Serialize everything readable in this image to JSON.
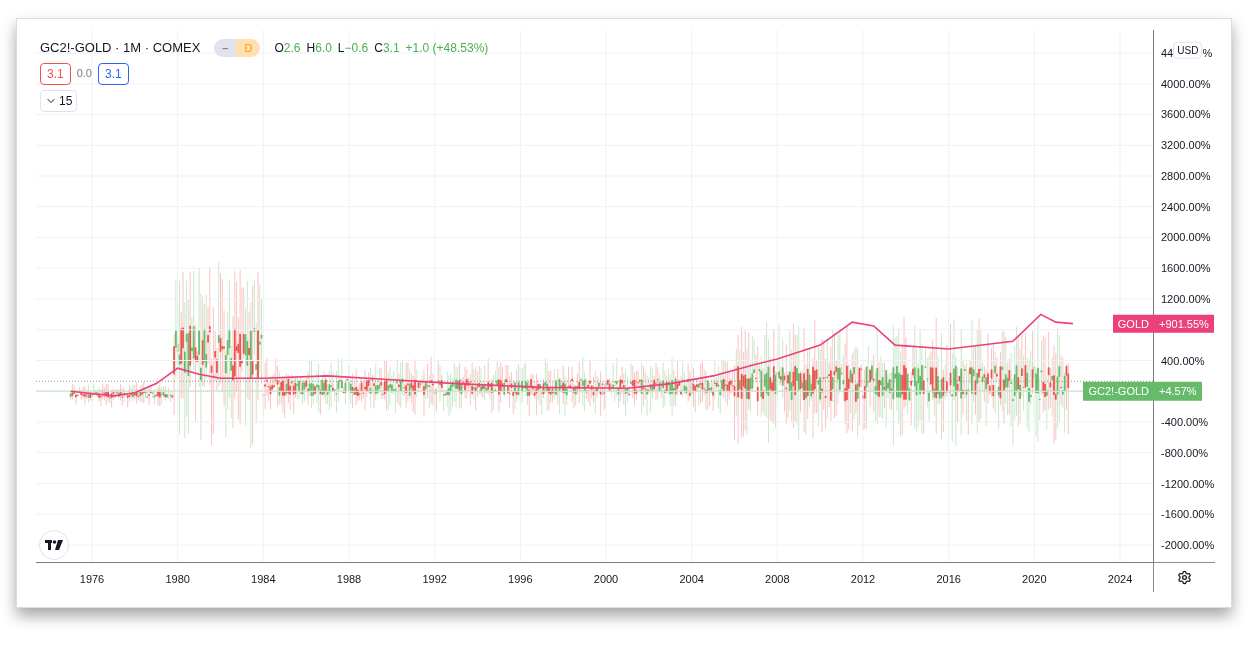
{
  "legend": {
    "symbol": "GC2!-GOLD · 1M · COMEX",
    "badges": [
      {
        "kind": "minus",
        "label": "–"
      },
      {
        "kind": "interval",
        "label": "D"
      }
    ],
    "ohlc": [
      {
        "key": "O",
        "value": "2.6"
      },
      {
        "key": "H",
        "value": "6.0"
      },
      {
        "key": "L",
        "value": "−0.6"
      },
      {
        "key": "C",
        "value": "3.1"
      }
    ],
    "change": "+1.0 (+48.53%)",
    "indicator_values": [
      {
        "kind": "boxed",
        "value": "3.1",
        "color": "#ef5350"
      },
      {
        "kind": "plain",
        "value": "0.0"
      },
      {
        "kind": "boxed",
        "value": "3.1",
        "color": "#2962ff"
      }
    ],
    "collapse_button": {
      "label": "15"
    }
  },
  "plot": {
    "chart_data": {
      "type": "line",
      "x": [
        1975,
        1977,
        1978,
        1979,
        1980,
        1981,
        1982,
        1984,
        1987,
        1990,
        1993,
        1997,
        2001,
        2003,
        2005,
        2007,
        2008,
        2010,
        2011.5,
        2012.5,
        2013.5,
        2016,
        2019,
        2020.3,
        2021,
        2021.8
      ],
      "series": [
        {
          "name": "GOLD",
          "color": "#ec407a",
          "values": [
            0,
            -60,
            -20,
            100,
            300,
            220,
            170,
            170,
            200,
            150,
            100,
            50,
            40,
            100,
            200,
            350,
            420,
            600,
            900,
            850,
            600,
            550,
            650,
            1000,
            900,
            880
          ]
        }
      ],
      "xlim": [
        1973.385,
        2025.54
      ],
      "ylim": [
        -2221,
        4699
      ],
      "grid": true,
      "yticks": [
        {
          "value": 4000,
          "label": "4000.00%"
        },
        {
          "value": 3600,
          "label": "3600.00%"
        },
        {
          "value": 3200,
          "label": "3200.00%"
        },
        {
          "value": 2800,
          "label": "2800.00%"
        },
        {
          "value": 2400,
          "label": "2400.00%"
        },
        {
          "value": 2000,
          "label": "2000.00%"
        },
        {
          "value": 1600,
          "label": "1600.00%"
        },
        {
          "value": 1200,
          "label": "1200.00%"
        },
        {
          "value": 400,
          "label": "400.00%"
        },
        {
          "value": -400,
          "label": "-400.00%"
        },
        {
          "value": -800,
          "label": "-800.00%"
        },
        {
          "value": -1200,
          "label": "-1200.00%"
        },
        {
          "value": -1600,
          "label": "-1600.00%"
        },
        {
          "value": -2000,
          "label": "-2000.00%"
        }
      ],
      "xticks": [
        {
          "value": 1976,
          "label": "1976"
        },
        {
          "value": 1980,
          "label": "1980"
        },
        {
          "value": 1984,
          "label": "1984"
        },
        {
          "value": 1988,
          "label": "1988"
        },
        {
          "value": 1992,
          "label": "1992"
        },
        {
          "value": 1996,
          "label": "1996"
        },
        {
          "value": 2000,
          "label": "2000"
        },
        {
          "value": 2004,
          "label": "2004"
        },
        {
          "value": 2008,
          "label": "2008"
        },
        {
          "value": 2012,
          "label": "2012"
        },
        {
          "value": 2016,
          "label": "2016"
        },
        {
          "value": 2020,
          "label": "2020"
        },
        {
          "value": 2024,
          "label": "2024"
        }
      ]
    }
  },
  "price_axis": {
    "currency": "USD",
    "cut_tick": [
      "44",
      "%"
    ],
    "labels": [
      {
        "kind": "compare",
        "value": "+901.55%"
      },
      {
        "kind": "main",
        "name": "GC2!-GOLD",
        "value": "+4.57%",
        "color": "#66bb6a"
      }
    ]
  }
}
